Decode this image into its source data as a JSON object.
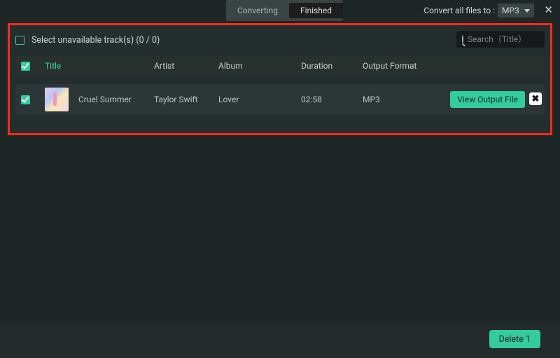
{
  "topbar": {
    "tab_converting": "Converting",
    "tab_finished": "Finished",
    "convert_label": "Convert all files to :",
    "format_selected": "MP3",
    "close_glyph": "✕"
  },
  "selrow": {
    "label": "Select unavailable track(s) (0 / 0)"
  },
  "search": {
    "placeholder": "Search（Title）"
  },
  "headers": {
    "title": "Title",
    "artist": "Artist",
    "album": "Album",
    "duration": "Duration",
    "output_format": "Output Format"
  },
  "tracks": [
    {
      "title": "Cruel Summer",
      "artist": "Taylor Swift",
      "album": "Lover",
      "duration": "02:58",
      "output_format": "MP3",
      "view_button": "View Output File"
    }
  ],
  "bottom": {
    "delete_label": "Delete 1"
  }
}
